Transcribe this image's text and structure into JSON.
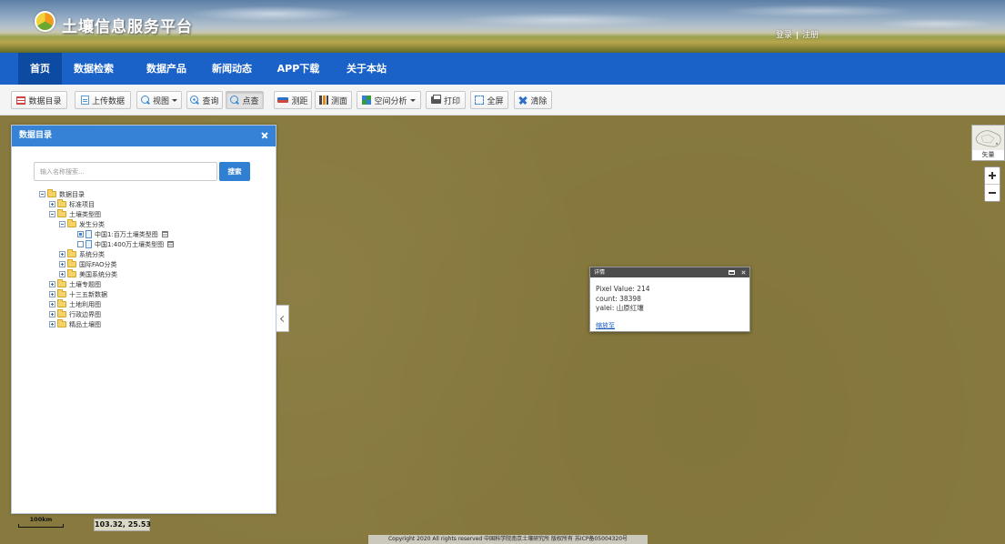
{
  "header": {
    "title": "土壤信息服务平台",
    "login": "登录",
    "register": "注册"
  },
  "nav": {
    "items": [
      {
        "label": "首页",
        "active": true
      },
      {
        "label": "数据检索"
      },
      {
        "label": "数据产品"
      },
      {
        "label": "新闻动态"
      },
      {
        "label": "APP下载"
      },
      {
        "label": "关于本站"
      }
    ]
  },
  "toolbar": {
    "items": [
      {
        "label": "数据目录",
        "icon": "catalog-icon"
      },
      {
        "label": "上传数据",
        "icon": "upload-file-icon"
      },
      {
        "label": "视图",
        "icon": "search-icon",
        "dropdown": true
      },
      {
        "label": "查询",
        "icon": "query-icon"
      },
      {
        "label": "点查",
        "icon": "point-query-icon",
        "active": true
      },
      {
        "label": "测距",
        "icon": "measure-distance-icon"
      },
      {
        "label": "测面",
        "icon": "measure-area-icon"
      },
      {
        "label": "空间分析",
        "icon": "spatial-analysis-icon",
        "dropdown": true
      },
      {
        "label": "打印",
        "icon": "printer-icon"
      },
      {
        "label": "全屏",
        "icon": "fullscreen-icon"
      },
      {
        "label": "清除",
        "icon": "clear-icon"
      }
    ]
  },
  "catalog": {
    "title": "数据目录",
    "search": {
      "value": "",
      "placeholder": "输入名称搜索...",
      "button": "搜索"
    },
    "tree": {
      "label": "数据目录",
      "children": [
        {
          "label": "标准项目"
        },
        {
          "label": "土壤类型图",
          "children": [
            {
              "label": "发生分类",
              "children": [
                {
                  "label": "中国1:百万土壤类型图",
                  "checked": true
                },
                {
                  "label": "中国1:400万土壤类型图",
                  "checked": false
                }
              ]
            },
            {
              "label": "系统分类"
            },
            {
              "label": "国际FAO分类"
            },
            {
              "label": "美国系统分类"
            }
          ]
        },
        {
          "label": "土壤专题图"
        },
        {
          "label": "十三五新数据"
        },
        {
          "label": "土地利用图"
        },
        {
          "label": "行政边界图"
        },
        {
          "label": "精品土壤图"
        }
      ]
    }
  },
  "popup": {
    "title": "详情",
    "fields": [
      {
        "key": "Pixel Value",
        "value": "214"
      },
      {
        "key": "count",
        "value": "38398"
      },
      {
        "key": "yalei",
        "value": "山原红壤"
      }
    ],
    "link": "缩放至"
  },
  "basemap": {
    "label": "矢量"
  },
  "status": {
    "scale": "100km",
    "coordinates": "103.32, 25.53"
  },
  "footer": {
    "copyright": "Copyright 2020 All rights reserved 中国科学院南京土壤研究所 版权所有 苏ICP备05004320号"
  },
  "colors": {
    "nav": "#1a62c7",
    "nav_active": "#0d4aa1",
    "panel_header": "#3582d6",
    "accent": "#2f7fd3",
    "map": "#887a3e",
    "popup_header": "#4d4d4d",
    "link": "#1a5bbf"
  }
}
